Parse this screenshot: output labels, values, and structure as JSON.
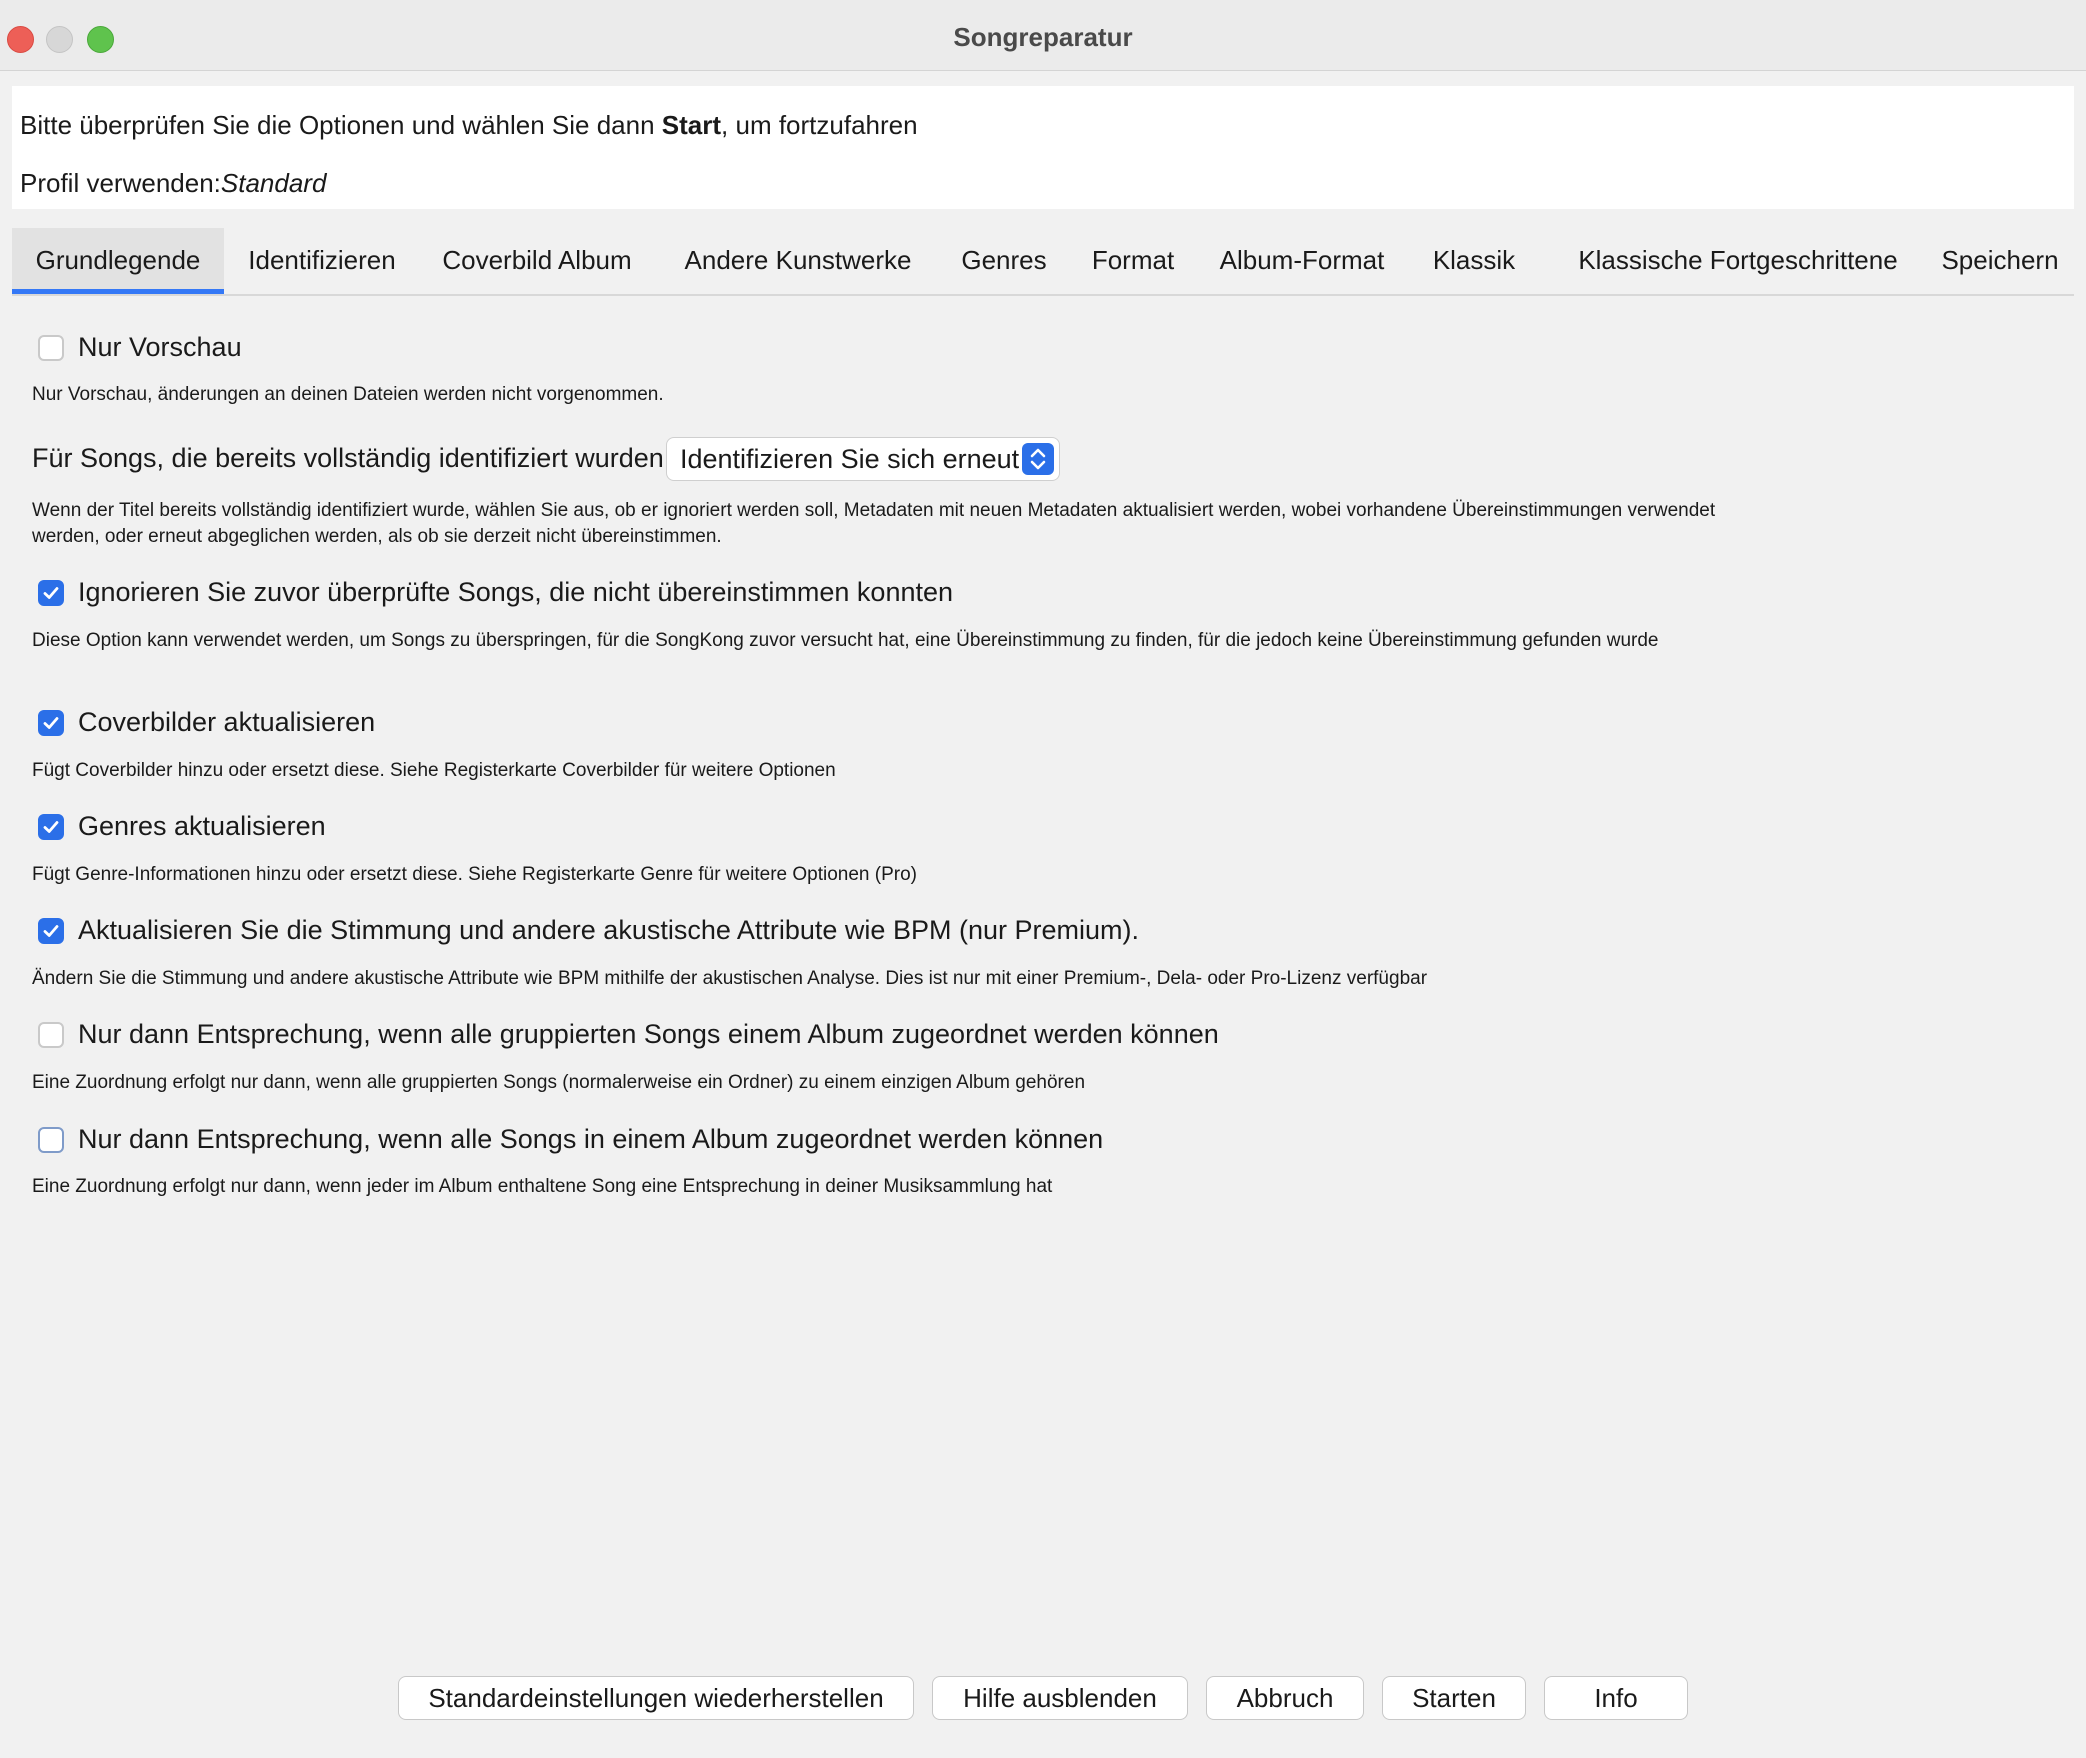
{
  "window": {
    "title": "Songreparatur"
  },
  "header": {
    "intro_prefix": "Bitte überprüfen Sie die Optionen und wählen Sie dann ",
    "intro_bold": "Start",
    "intro_suffix": ", um fortzufahren",
    "profile_label": "Profil verwenden:",
    "profile_value": "Standard"
  },
  "tabs": [
    {
      "label": "Grundlegende",
      "active": true
    },
    {
      "label": "Identifizieren"
    },
    {
      "label": "Coverbild Album"
    },
    {
      "label": "Andere Kunstwerke"
    },
    {
      "label": "Genres"
    },
    {
      "label": "Format"
    },
    {
      "label": "Album-Format"
    },
    {
      "label": "Klassik"
    },
    {
      "label": "Klassische Fortgeschrittene"
    },
    {
      "label": "Speichern"
    }
  ],
  "options": {
    "preview": {
      "label": "Nur Vorschau",
      "checked": false,
      "help": "Nur Vorschau, änderungen an deinen Dateien werden nicht vorgenommen."
    },
    "identified": {
      "label": "Für Songs, die bereits vollständig identifiziert wurden",
      "value": "Identifizieren Sie sich erneut",
      "help": "Wenn der Titel bereits vollständig identifiziert wurde, wählen Sie aus, ob er ignoriert werden soll, Metadaten mit neuen Metadaten aktualisiert werden, wobei vorhandene Übereinstimmungen verwendet werden, oder erneut abgeglichen werden, als ob sie derzeit nicht übereinstimmen."
    },
    "ignore_unmatched": {
      "label": "Ignorieren Sie zuvor überprüfte Songs, die nicht übereinstimmen konnten",
      "checked": true,
      "help": "Diese Option kann verwendet werden, um Songs zu überspringen, für die SongKong zuvor versucht hat, eine Übereinstimmung zu finden, für die jedoch keine Übereinstimmung gefunden wurde"
    },
    "cover": {
      "label": "Coverbilder aktualisieren",
      "checked": true,
      "help": "Fügt Coverbilder hinzu oder ersetzt diese. Siehe Registerkarte Coverbilder für weitere Optionen"
    },
    "genres": {
      "label": "Genres aktualisieren",
      "checked": true,
      "help": "Fügt Genre-Informationen hinzu oder ersetzt diese. Siehe Registerkarte Genre für weitere Optionen (Pro)"
    },
    "mood": {
      "label": "Aktualisieren Sie die Stimmung und andere akustische Attribute wie BPM (nur Premium).",
      "checked": true,
      "help": "Ändern Sie die Stimmung und andere akustische Attribute wie BPM mithilfe der akustischen Analyse. Dies ist nur mit einer Premium-, Dela- oder Pro-Lizenz verfügbar"
    },
    "grouped": {
      "label": "Nur dann Entsprechung, wenn alle gruppierten Songs einem Album zugeordnet werden können",
      "checked": false,
      "help": "Eine Zuordnung erfolgt nur dann, wenn alle gruppierten Songs (normalerweise ein Ordner) zu einem einzigen Album gehören"
    },
    "all_songs": {
      "label": "Nur dann Entsprechung, wenn alle Songs in einem Album zugeordnet werden können",
      "checked": false,
      "help": "Eine Zuordnung erfolgt nur dann, wenn jeder im Album enthaltene Song eine Entsprechung in deiner Musiksammlung hat"
    }
  },
  "buttons": {
    "restore": "Standardeinstellungen wiederherstellen",
    "hide_help": "Hilfe ausblenden",
    "cancel": "Abbruch",
    "start": "Starten",
    "info": "Info"
  },
  "colors": {
    "accent": "#2b6fe8"
  }
}
